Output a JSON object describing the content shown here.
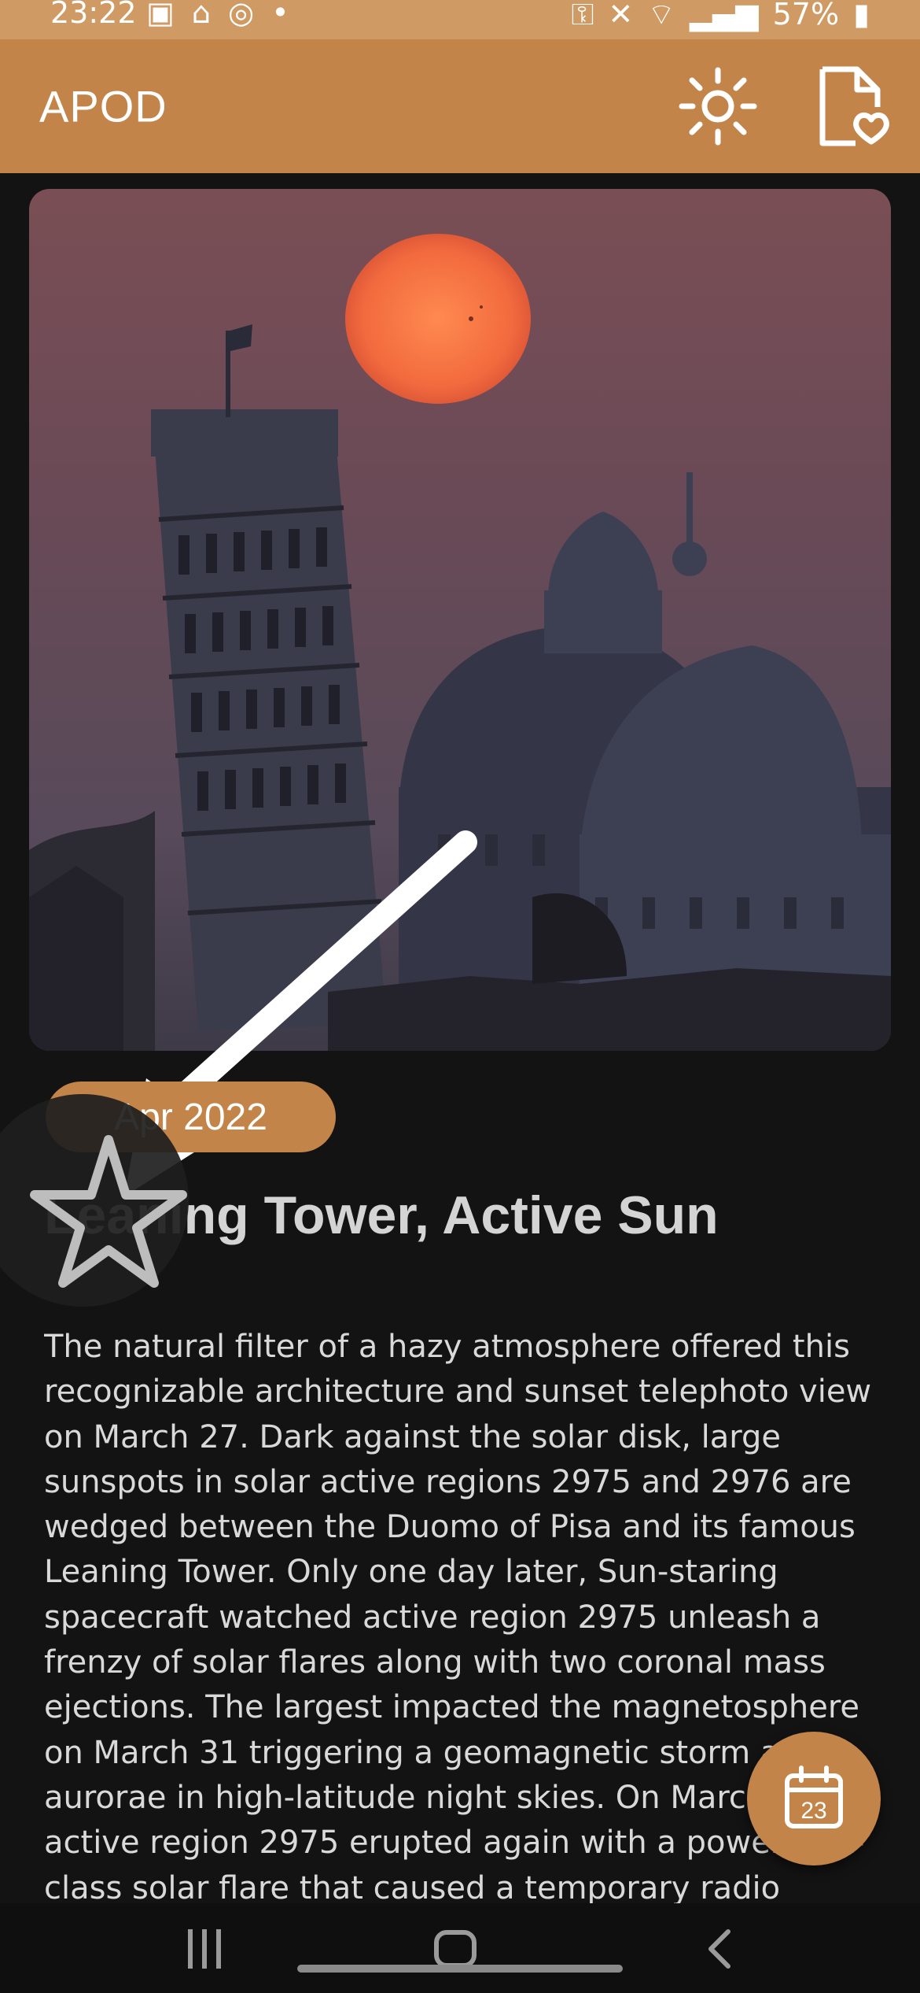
{
  "status_bar": {
    "time": "23:22",
    "battery": "57%"
  },
  "app_bar": {
    "title": "APOD",
    "icons": [
      "brightness-icon",
      "favorites-document-icon"
    ]
  },
  "apod": {
    "date_chip": "Apr 2022",
    "title": "Leaning Tower, Active Sun",
    "description": "The natural filter of a hazy atmosphere offered this recognizable architecture and sunset telephoto view on March 27. Dark against the solar disk, large sunspots in solar active regions 2975 and 2976 are wedged between the Duomo of Pisa and its famous Leaning Tower. Only one day later, Sun-staring spacecraft watched active region 2975 unleash a frenzy of solar flares along with two coronal mass ejections. The largest impacted the magnetosphere on March 31 triggering a geomagnetic storm and aurorae in high-latitude night skies. On March 30 active region 2975 erupted again with a powerful X-class solar flare that caused a temporary radio"
  },
  "fab": {
    "calendar_day": "23"
  },
  "colors": {
    "accent": "#c38449",
    "status_bar": "#cf9a63",
    "background": "#131313"
  }
}
